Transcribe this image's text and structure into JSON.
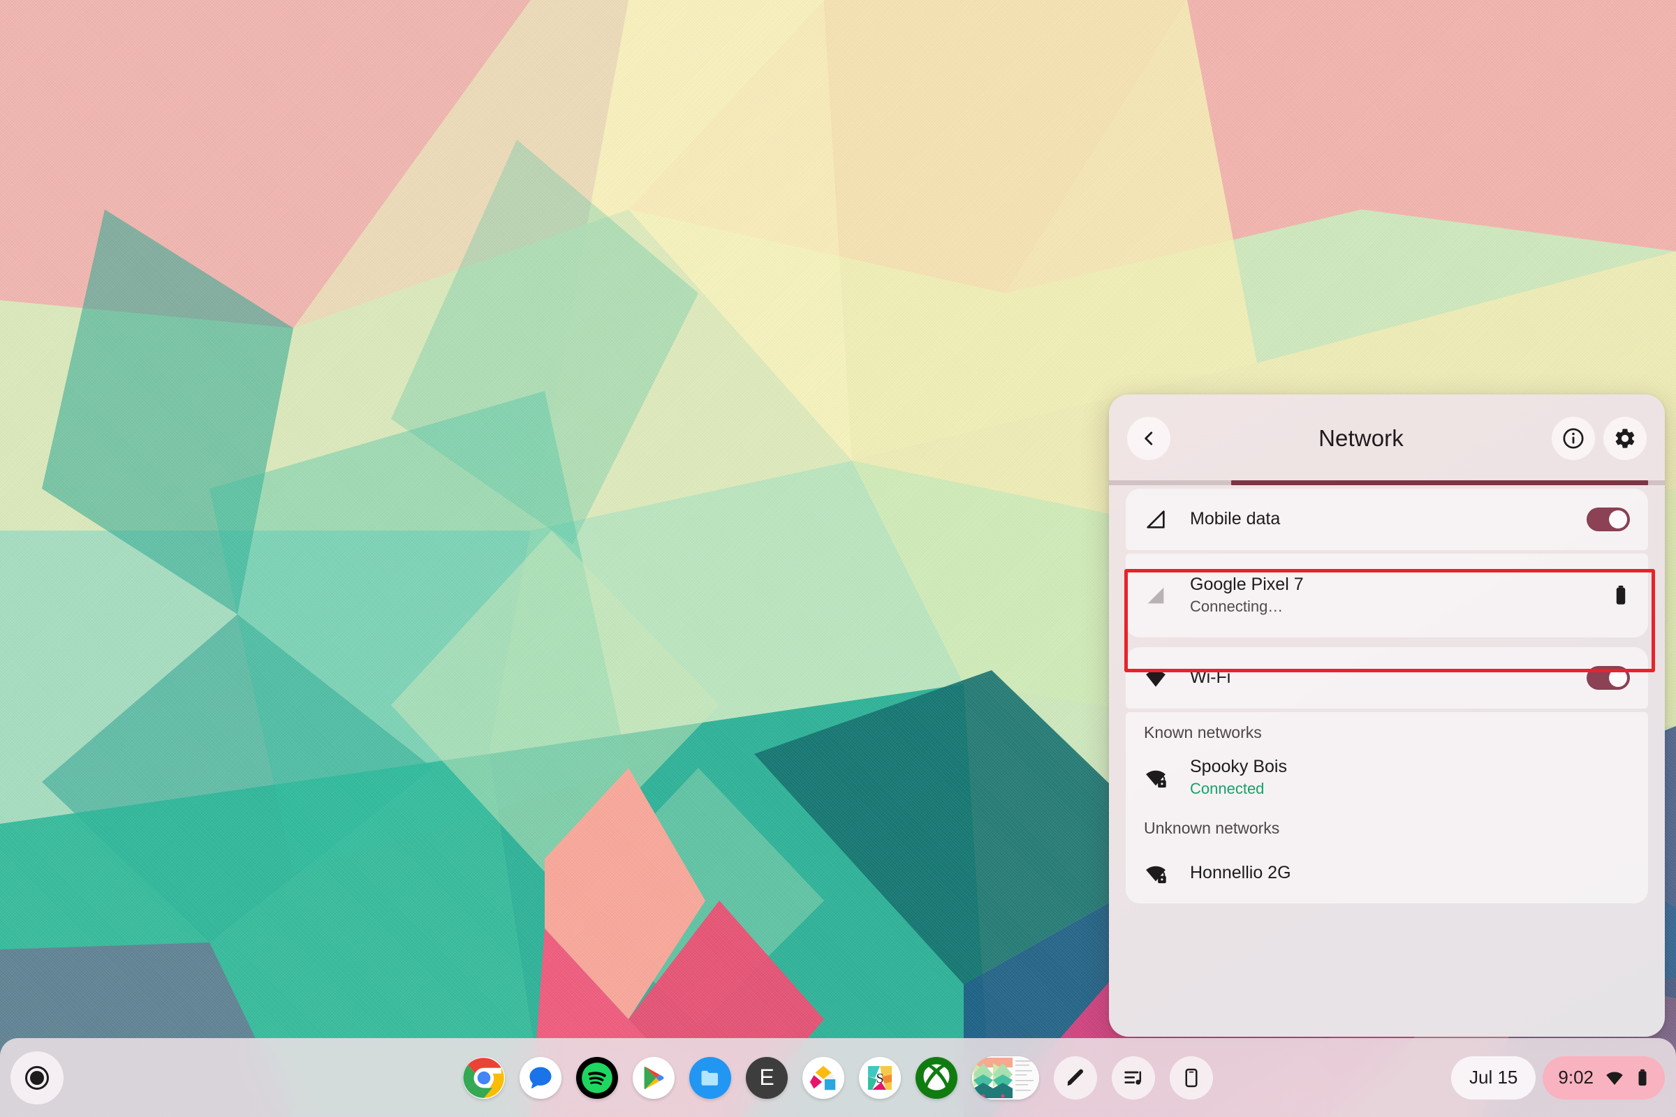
{
  "wallpaper": {
    "name": "geometric-low-poly-wallpaper",
    "palette": [
      "#f2b3ae",
      "#f6f1bd",
      "#e8eec2",
      "#bfe3bd",
      "#6fcdae",
      "#2ab795",
      "#1f9f8c",
      "#187f79",
      "#1c5f84",
      "#2a5f93",
      "#e8576f",
      "#f59a8e",
      "#f6a0c2",
      "#8b8fa8"
    ]
  },
  "panel": {
    "header": {
      "title": "Network",
      "back_icon": "chevron-left-icon",
      "info_icon": "info-icon",
      "settings_icon": "gear-icon"
    },
    "progress": {
      "visible": true,
      "color": "#7d3444",
      "start_pct": 22,
      "width_pct": 75
    },
    "rows": [
      {
        "id": "mobile-data",
        "icon": "cellular-signal-icon",
        "title": "Mobile data",
        "subtitle": "",
        "trailing": "toggle",
        "toggle_on": true,
        "highlighted": false
      },
      {
        "id": "google-pixel-7",
        "icon": "cellular-signal-dim-icon",
        "title": "Google Pixel 7",
        "subtitle": "Connecting…",
        "trailing": "battery",
        "toggle_on": false,
        "highlighted": true
      },
      {
        "id": "wifi",
        "icon": "wifi-icon",
        "title": "Wi-Fi",
        "subtitle": "",
        "trailing": "toggle",
        "toggle_on": true,
        "highlighted": false
      }
    ],
    "known_networks_label": "Known networks",
    "known_networks": [
      {
        "id": "spooky-bois",
        "icon": "wifi-lock-icon",
        "name": "Spooky Bois",
        "status": "Connected",
        "status_color": "#18a06a"
      }
    ],
    "unknown_networks_label": "Unknown networks",
    "unknown_networks": [
      {
        "id": "honnellio-2g",
        "icon": "wifi-lock-icon",
        "name": "Honnellio 2G",
        "status": "",
        "status_color": ""
      }
    ],
    "highlight_color": "#e8232a",
    "toggle_on_color": "#8c4155"
  },
  "shelf": {
    "launcher_label": "Launcher",
    "apps": [
      {
        "id": "chrome",
        "name": "Chrome"
      },
      {
        "id": "messages",
        "name": "Messages"
      },
      {
        "id": "spotify",
        "name": "Spotify"
      },
      {
        "id": "play-store",
        "name": "Play Store"
      },
      {
        "id": "files",
        "name": "Files"
      },
      {
        "id": "e-app",
        "name": "E",
        "letter": "E"
      },
      {
        "id": "colorful-app",
        "name": "Colorful App"
      },
      {
        "id": "s-app",
        "name": "S",
        "letter": "S"
      },
      {
        "id": "xbox",
        "name": "Xbox"
      }
    ],
    "window_preview_label": "Window preview",
    "tray_icons": [
      {
        "id": "stylus",
        "name": "stylus-icon"
      },
      {
        "id": "media",
        "name": "media-playlist-icon"
      },
      {
        "id": "phone",
        "name": "phone-hub-icon"
      }
    ],
    "date": "Jul 15",
    "clock": "9:02",
    "status_wifi_icon": "wifi-icon",
    "status_battery_icon": "battery-icon",
    "status_pill_color": "#f9b2c0"
  }
}
